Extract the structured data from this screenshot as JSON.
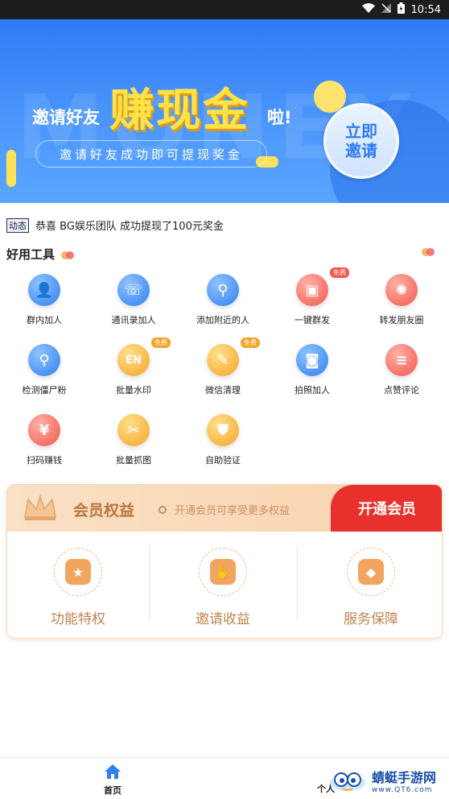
{
  "status_bar": {
    "time": "10:54"
  },
  "banner": {
    "bg_text": "MONEY",
    "invite_text": "邀请好友",
    "big_text": "赚现金",
    "la_text": "啦!",
    "subtitle": "邀请好友成功即可提现奖金",
    "cta_line1": "立即",
    "cta_line2": "邀请"
  },
  "ticker": {
    "tag": "动态",
    "message": "恭喜 BG娱乐团队 成功提现了100元奖金"
  },
  "tools": {
    "title": "好用工具",
    "free_badge": "免费",
    "items": [
      {
        "label": "群内加人",
        "icon": "user-group-icon",
        "color": "blue"
      },
      {
        "label": "通讯录加人",
        "icon": "contacts-icon",
        "color": "blue"
      },
      {
        "label": "添加附近的人",
        "icon": "location-pin-icon",
        "color": "blue"
      },
      {
        "label": "一键群发",
        "icon": "chat-bubble-icon",
        "color": "red"
      },
      {
        "label": "转发朋友圈",
        "icon": "aperture-icon",
        "color": "red"
      },
      {
        "label": "检测僵尸粉",
        "icon": "search-icon",
        "color": "blue"
      },
      {
        "label": "批量水印",
        "icon": "watermark-icon",
        "color": "orange"
      },
      {
        "label": "微信清理",
        "icon": "broom-icon",
        "color": "orange"
      },
      {
        "label": "拍照加人",
        "icon": "camera-icon",
        "color": "blue"
      },
      {
        "label": "点赞评论",
        "icon": "comment-icon",
        "color": "red"
      },
      {
        "label": "扫码赚钱",
        "icon": "money-bag-icon",
        "color": "red"
      },
      {
        "label": "批量抓图",
        "icon": "scissors-icon",
        "color": "orange"
      },
      {
        "label": "自助验证",
        "icon": "shield-icon",
        "color": "orange"
      }
    ]
  },
  "member": {
    "title": "会员权益",
    "subtitle": "开通会员可享受更多权益",
    "open_button": "开通会员",
    "benefits": [
      {
        "label": "功能特权",
        "icon": "medal-icon"
      },
      {
        "label": "邀请收益",
        "icon": "hand-coins-icon"
      },
      {
        "label": "服务保障",
        "icon": "service-icon"
      }
    ]
  },
  "bottom_nav": {
    "home": "首页",
    "me": "个人"
  },
  "watermark": {
    "title": "蜻蜓手游网",
    "url": "www.QT6.com"
  }
}
